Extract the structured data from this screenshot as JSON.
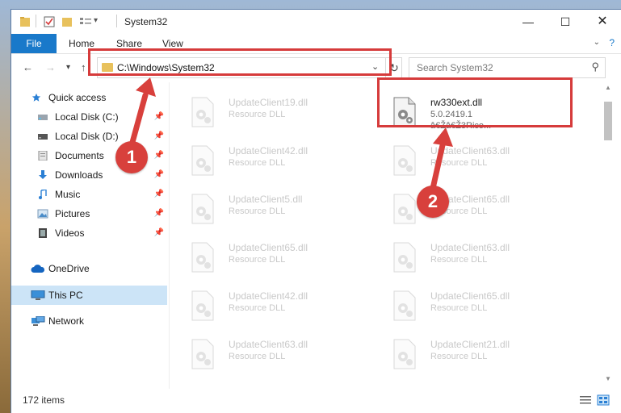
{
  "window": {
    "title": "System32"
  },
  "ribbon": {
    "tabs": [
      "File",
      "Home",
      "Share",
      "View"
    ]
  },
  "address": {
    "path": "C:\\Windows\\System32"
  },
  "search": {
    "placeholder": "Search System32"
  },
  "sidebar": {
    "items": [
      {
        "label": "Quick access",
        "icon": "star-icon"
      },
      {
        "label": "Local Disk (C:)",
        "icon": "drive-icon"
      },
      {
        "label": "Local Disk (D:)",
        "icon": "drive-icon"
      },
      {
        "label": "Documents",
        "icon": "documents-icon"
      },
      {
        "label": "Downloads",
        "icon": "download-icon"
      },
      {
        "label": "Music",
        "icon": "music-icon"
      },
      {
        "label": "Pictures",
        "icon": "pictures-icon"
      },
      {
        "label": "Videos",
        "icon": "videos-icon"
      },
      {
        "label": "OneDrive",
        "icon": "cloud-icon"
      },
      {
        "label": "This PC",
        "icon": "computer-icon"
      },
      {
        "label": "Network",
        "icon": "network-icon"
      }
    ]
  },
  "files": {
    "col1": [
      {
        "name": "UpdateClient19.dll",
        "type": "Resource DLL"
      },
      {
        "name": "UpdateClient42.dll",
        "type": "Resource DLL"
      },
      {
        "name": "UpdateClient5.dll",
        "type": "Resource DLL"
      },
      {
        "name": "UpdateClient65.dll",
        "type": "Resource DLL"
      },
      {
        "name": "UpdateClient42.dll",
        "type": "Resource DLL"
      },
      {
        "name": "UpdateClient63.dll",
        "type": "Resource DLL"
      }
    ],
    "selected": {
      "name": "rw330ext.dll",
      "version": "5.0.2419.1",
      "company": "â€Žâ€Ž3Rico..."
    },
    "col2": [
      {
        "name": "UpdateClient63.dll",
        "type": "Resource DLL"
      },
      {
        "name": "UpdateClient65.dll",
        "type": "Resource DLL"
      },
      {
        "name": "UpdateClient63.dll",
        "type": "Resource DLL"
      },
      {
        "name": "UpdateClient65.dll",
        "type": "Resource DLL"
      },
      {
        "name": "UpdateClient21.dll",
        "type": "Resource DLL"
      }
    ]
  },
  "status": {
    "count": "172 items"
  },
  "annotations": {
    "step1": "1",
    "step2": "2"
  },
  "colors": {
    "accent": "#1979ca",
    "highlight": "#d63b3b",
    "selection": "#cce4f7"
  }
}
